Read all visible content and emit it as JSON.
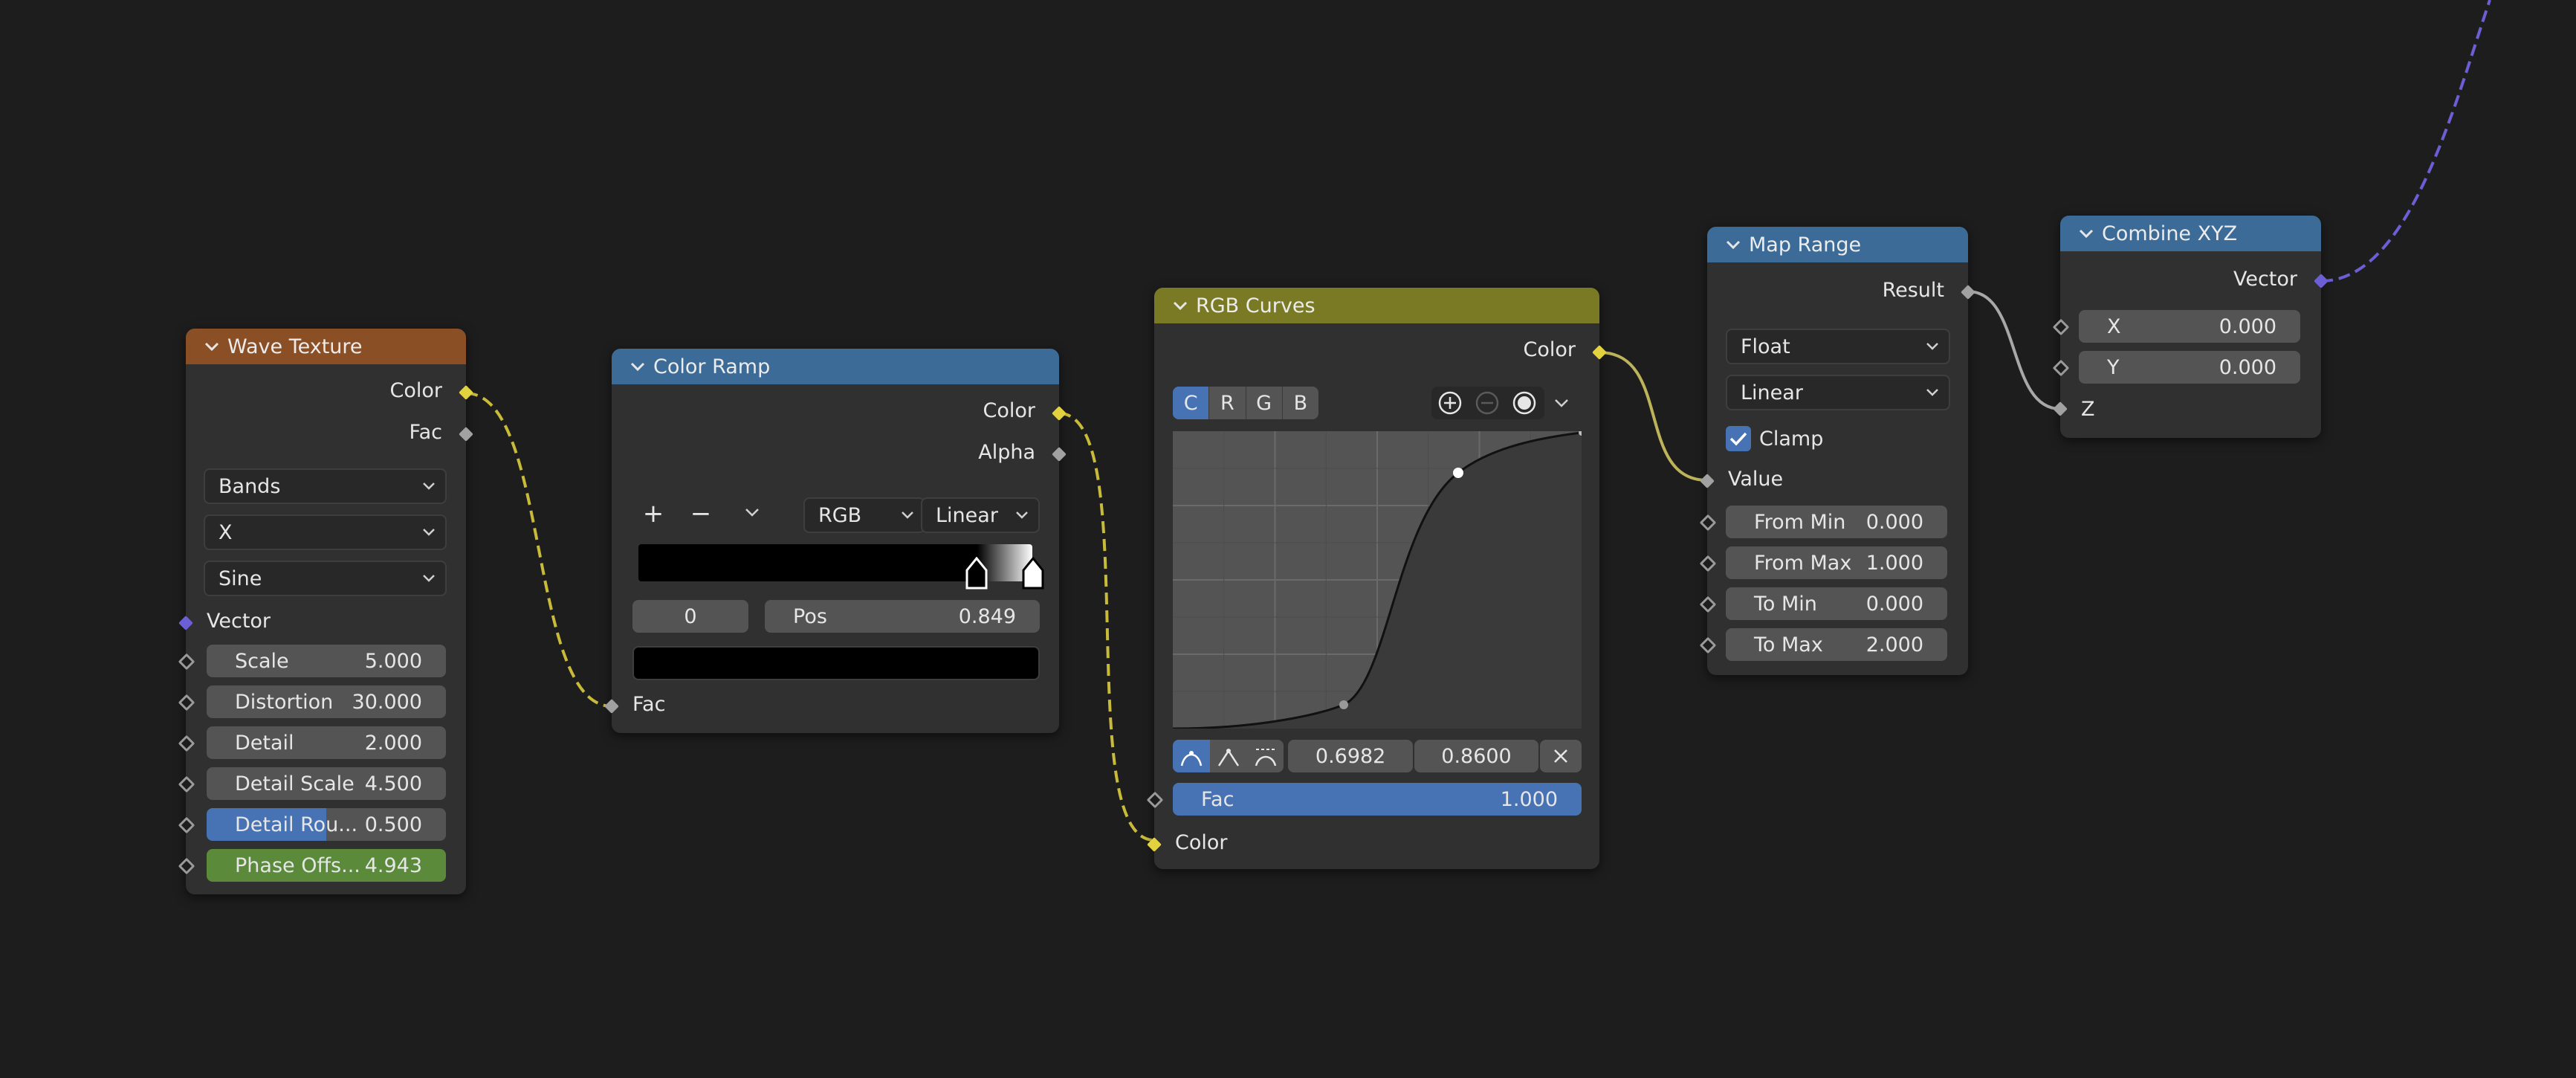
{
  "wave": {
    "title": "Wave Texture",
    "out_color": "Color",
    "out_fac": "Fac",
    "type": "Bands",
    "direction": "X",
    "profile": "Sine",
    "in_vector": "Vector",
    "fields": [
      {
        "label": "Scale",
        "value": "5.000"
      },
      {
        "label": "Distortion",
        "value": "30.000"
      },
      {
        "label": "Detail",
        "value": "2.000"
      },
      {
        "label": "Detail Scale",
        "value": "4.500"
      },
      {
        "label": "Detail Rou...",
        "value": "0.500",
        "fill": 0.5
      },
      {
        "label": "Phase Offs...",
        "value": "4.943",
        "fill": 1.0
      }
    ],
    "header_color": "#8b4f26"
  },
  "ramp": {
    "title": "Color Ramp",
    "out_color": "Color",
    "out_alpha": "Alpha",
    "add": "+",
    "remove": "−",
    "color_mode": "RGB",
    "interpolation": "Linear",
    "index": "0",
    "pos_label": "Pos",
    "pos_value": "0.849",
    "in_fac": "Fac",
    "header_color": "#3c6b97"
  },
  "curves": {
    "title": "RGB Curves",
    "out_color": "Color",
    "tabs": [
      "C",
      "R",
      "G",
      "B"
    ],
    "active_tab": "C",
    "point_x": "0.6982",
    "point_y": "0.8600",
    "fac_label": "Fac",
    "fac_value": "1.000",
    "in_color": "Color",
    "header_color": "#7a7a25"
  },
  "maprange": {
    "title": "Map Range",
    "out_result": "Result",
    "data_type": "Float",
    "interpolation": "Linear",
    "clamp_label": "Clamp",
    "clamp_checked": true,
    "in_value": "Value",
    "fields": [
      {
        "label": "From Min",
        "value": "0.000"
      },
      {
        "label": "From Max",
        "value": "1.000"
      },
      {
        "label": "To Min",
        "value": "0.000"
      },
      {
        "label": "To Max",
        "value": "2.000"
      }
    ],
    "header_color": "#3c6b97"
  },
  "combine": {
    "title": "Combine XYZ",
    "out_vector": "Vector",
    "fields": [
      {
        "label": "X",
        "value": "0.000"
      },
      {
        "label": "Y",
        "value": "0.000"
      }
    ],
    "in_z": "Z",
    "header_color": "#3c6b97"
  }
}
